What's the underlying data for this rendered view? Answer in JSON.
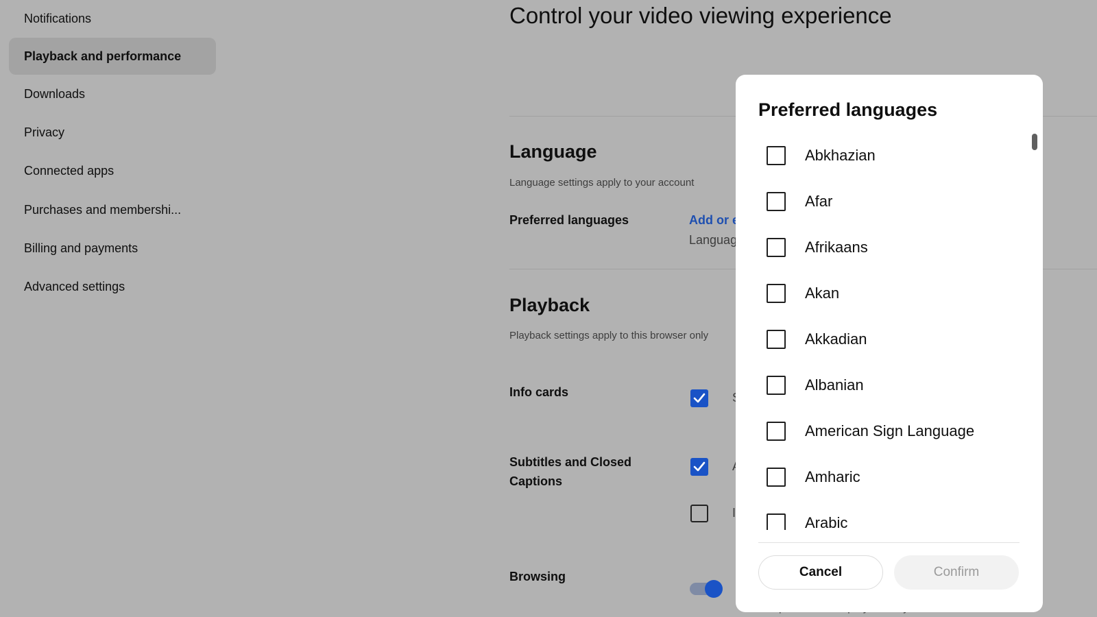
{
  "sidebar": {
    "items": [
      {
        "label": "Notifications",
        "active": false
      },
      {
        "label": "Playback and performance",
        "active": true
      },
      {
        "label": "Downloads",
        "active": false
      },
      {
        "label": "Privacy",
        "active": false
      },
      {
        "label": "Connected apps",
        "active": false
      },
      {
        "label": "Purchases and membershi...",
        "active": false
      },
      {
        "label": "Billing and payments",
        "active": false
      },
      {
        "label": "Advanced settings",
        "active": false
      }
    ]
  },
  "main": {
    "title": "Control your video viewing experience",
    "language": {
      "title": "Language",
      "subtitle": "Language settings apply to your account",
      "preferred_label": "Preferred languages",
      "link_text": "Add or e",
      "sub_text": "Languag"
    },
    "playback": {
      "title": "Playback",
      "subtitle": "Playback settings apply to this browser only",
      "info_cards_label": "Info cards",
      "info_cards_text": "S",
      "subtitles_label": "Subtitles and Closed Captions",
      "subtitles_text1": "A",
      "subtitles_text2": "I",
      "browsing_label": "Browsing",
      "browsing_footnote": "Video previews will play when you hover over thumbnails"
    }
  },
  "dialog": {
    "title": "Preferred languages",
    "languages": [
      "Abkhazian",
      "Afar",
      "Afrikaans",
      "Akan",
      "Akkadian",
      "Albanian",
      "American Sign Language",
      "Amharic",
      "Arabic"
    ],
    "cancel_label": "Cancel",
    "confirm_label": "Confirm"
  },
  "colors": {
    "accent": "#1a53c6",
    "link": "#1e4fb0",
    "overlay_background": "#b2b2b2"
  }
}
